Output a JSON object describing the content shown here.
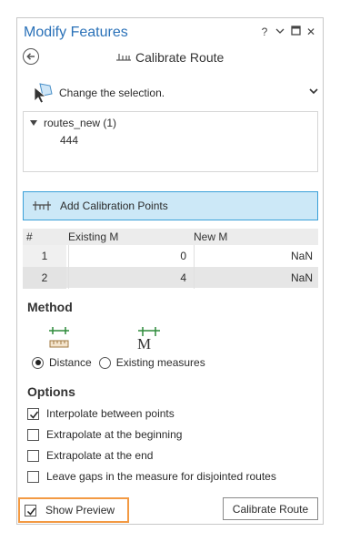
{
  "pane": {
    "title": "Modify Features",
    "title_color": "#2a71b8",
    "controls": [
      "help-icon",
      "menu-chevron-icon",
      "restore-icon",
      "close-icon"
    ],
    "help_glyph": "?",
    "close_glyph": "✕"
  },
  "tool": {
    "title": "Calibrate Route",
    "icon": "calibrate-route-icon"
  },
  "selection": {
    "label": "Change the selection.",
    "layer": "routes_new (1)",
    "feature_id": "444"
  },
  "calibration": {
    "add_label": "Add Calibration Points",
    "accent_bg": "#cce8f7",
    "accent_border": "#3aa0d8",
    "columns": [
      "#",
      "Existing M",
      "New M"
    ],
    "rows": [
      {
        "num": "1",
        "existing_m": "0",
        "new_m": "NaN"
      },
      {
        "num": "2",
        "existing_m": "4",
        "new_m": "NaN"
      }
    ]
  },
  "method": {
    "heading": "Method",
    "options": [
      {
        "label": "Distance",
        "selected": true,
        "icon": "distance-ruler-icon"
      },
      {
        "label": "Existing measures",
        "selected": false,
        "icon": "existing-measures-icon"
      }
    ],
    "m_glyph": "M"
  },
  "options": {
    "heading": "Options",
    "items": [
      {
        "label": "Interpolate between points",
        "checked": true
      },
      {
        "label": "Extrapolate at the beginning",
        "checked": false
      },
      {
        "label": "Extrapolate at the end",
        "checked": false
      },
      {
        "label": "Leave gaps in the measure for disjointed routes",
        "checked": false
      }
    ]
  },
  "footer": {
    "show_preview_label": "Show Preview",
    "show_preview_checked": true,
    "highlight_color": "#f39a43",
    "run_button": "Calibrate Route"
  }
}
